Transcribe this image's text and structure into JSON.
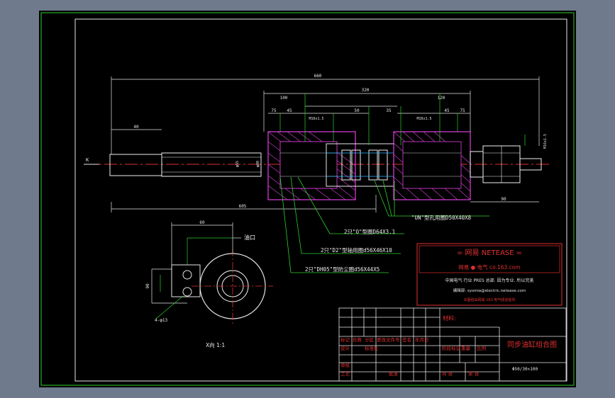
{
  "drawing": {
    "title": "同步油缸组合图",
    "scale": "X向 1:1",
    "part_code": "Φ50/30×100",
    "material_label": "材料:",
    "seals": {
      "o_ring": "2只\"O\"型圈D64X3.1",
      "dust_seal": "2只\"DH05\"型防尘圈d56X44X5",
      "rod_seal": "2只\"D2\"型轴用圈d56X46X10",
      "ring_seal": "\"UN\"型孔用圈D50X40X8"
    },
    "ports": {
      "oil_port": "油口",
      "hole_note": "4-φ13"
    },
    "dims": {
      "total": "660",
      "rod_end": "40",
      "lower": "605",
      "span": "320",
      "d1": "100",
      "d2": "75",
      "d3": "45",
      "d4": "120",
      "d5": "45",
      "d6": "75",
      "d7": "90",
      "d8": "50",
      "d9": "35",
      "right": "90",
      "thread_l": "M16x1.5",
      "thread_r": "M16x1.5",
      "bolt": "M16x1.5",
      "dia1": "φ55",
      "dia2": "φ80",
      "flange_w": "60",
      "flange_h": "90",
      "k_mark": "K"
    },
    "watermark": {
      "title": "=  网易  NETEASE  =",
      "site": "网易 ● 电气    co.163.com",
      "line1": "中国电气 行业 PRES 总部. 因为专业. 所以完美",
      "line2": "编辑部:  sysmia@electric.netease.com",
      "line3": "本图纸由网易 163 电气频道提供"
    },
    "title_block": {
      "r1": [
        "标记",
        "处数",
        "分区",
        "更改文件号",
        "签名",
        "年月日"
      ],
      "r2": [
        "设计",
        "",
        "标准化",
        "",
        "",
        "",
        "阶段标记",
        "重量",
        "比例"
      ],
      "r3": [
        "审核"
      ],
      "r4": [
        "工艺",
        "",
        "批准",
        "",
        "",
        "",
        "共  张",
        "第  张"
      ]
    }
  }
}
